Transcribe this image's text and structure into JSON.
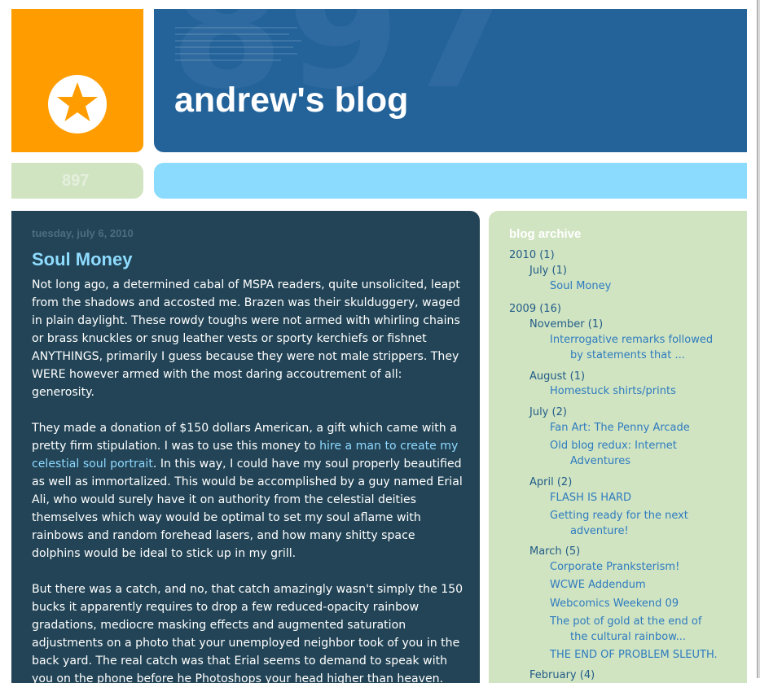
{
  "header": {
    "blog_title": "andrew's blog",
    "bg_number": "897",
    "count_label": "897"
  },
  "post": {
    "date": "tuesday, july 6, 2010",
    "title": "Soul Money",
    "p1": "Not long ago, a determined cabal of MSPA readers, quite unsolicited, leapt from the shadows and accosted me. Brazen was their skulduggery, waged in plain daylight. These rowdy toughs were not armed with whirling chains or brass knuckles or snug leather vests or sporty kerchiefs or fishnet ANYTHINGS, primarily I guess because they were not male strippers. They WERE however armed with the most daring accoutrement of all: generosity.",
    "p2_before": "They made a donation of $150 dollars American, a gift which came with a pretty firm stipulation. I was to use this money to ",
    "p2_link": "hire a man to create my celestial soul portrait",
    "p2_after": ". In this way, I could have my soul properly beautified as well as immortalized. This would be accomplished by a guy named Erial Ali, who would surely have it on authority from the celestial deities themselves which way would be optimal to set my soul aflame with rainbows and random forehead lasers, and how many shitty space dolphins would be ideal to stick up in my grill.",
    "p3": "But there was a catch, and no, that catch amazingly wasn't simply the 150 bucks it apparently requires to drop a few reduced-opacity rainbow gradations, mediocre masking effects and augmented saturation adjustments on a photo that your unemployed neighbor took of you in the back yard. The real catch was that Erial seems to demand to speak with you on the phone before he Photoshops your head higher than heaven."
  },
  "sidebar": {
    "title": "blog archive",
    "y2010": {
      "label": "2010",
      "count": "(1)"
    },
    "jul2010": {
      "label": "July",
      "count": "(1)"
    },
    "post_soul_money": "Soul Money",
    "y2009": {
      "label": "2009",
      "count": "(16)"
    },
    "nov2009": {
      "label": "November",
      "count": "(1)"
    },
    "post_interrogative_1": "Interrogative remarks followed",
    "post_interrogative_2": "by statements that ...",
    "aug2009": {
      "label": "August",
      "count": "(1)"
    },
    "post_homestuck": "Homestuck shirts/prints",
    "jul2009": {
      "label": "July",
      "count": "(2)"
    },
    "post_fanart": "Fan Art: The Penny Arcade",
    "post_redux_1": "Old blog redux: Internet",
    "post_redux_2": "Adventures",
    "apr2009": {
      "label": "April",
      "count": "(2)"
    },
    "post_flash": "FLASH IS HARD",
    "post_ready_1": "Getting ready for the next",
    "post_ready_2": "adventure!",
    "mar2009": {
      "label": "March",
      "count": "(5)"
    },
    "post_corporate": "Corporate Pranksterism!",
    "post_wcwe": "WCWE Addendum",
    "post_webcomics": "Webcomics Weekend 09",
    "post_pot_1": "The pot of gold at the end of",
    "post_pot_2": "the cultural rainbow...",
    "post_problem": "THE END OF PROBLEM SLEUTH.",
    "feb2009": {
      "label": "February",
      "count": "(4)"
    }
  },
  "colors": {
    "orange": "#ff9d00",
    "blue_header": "#23639a",
    "light_blue": "#8adbfe",
    "pale_green": "#d0e4c2",
    "dark_teal": "#224456",
    "title_cyan": "#8fdcff"
  },
  "icons": {
    "logo": "star-icon"
  }
}
